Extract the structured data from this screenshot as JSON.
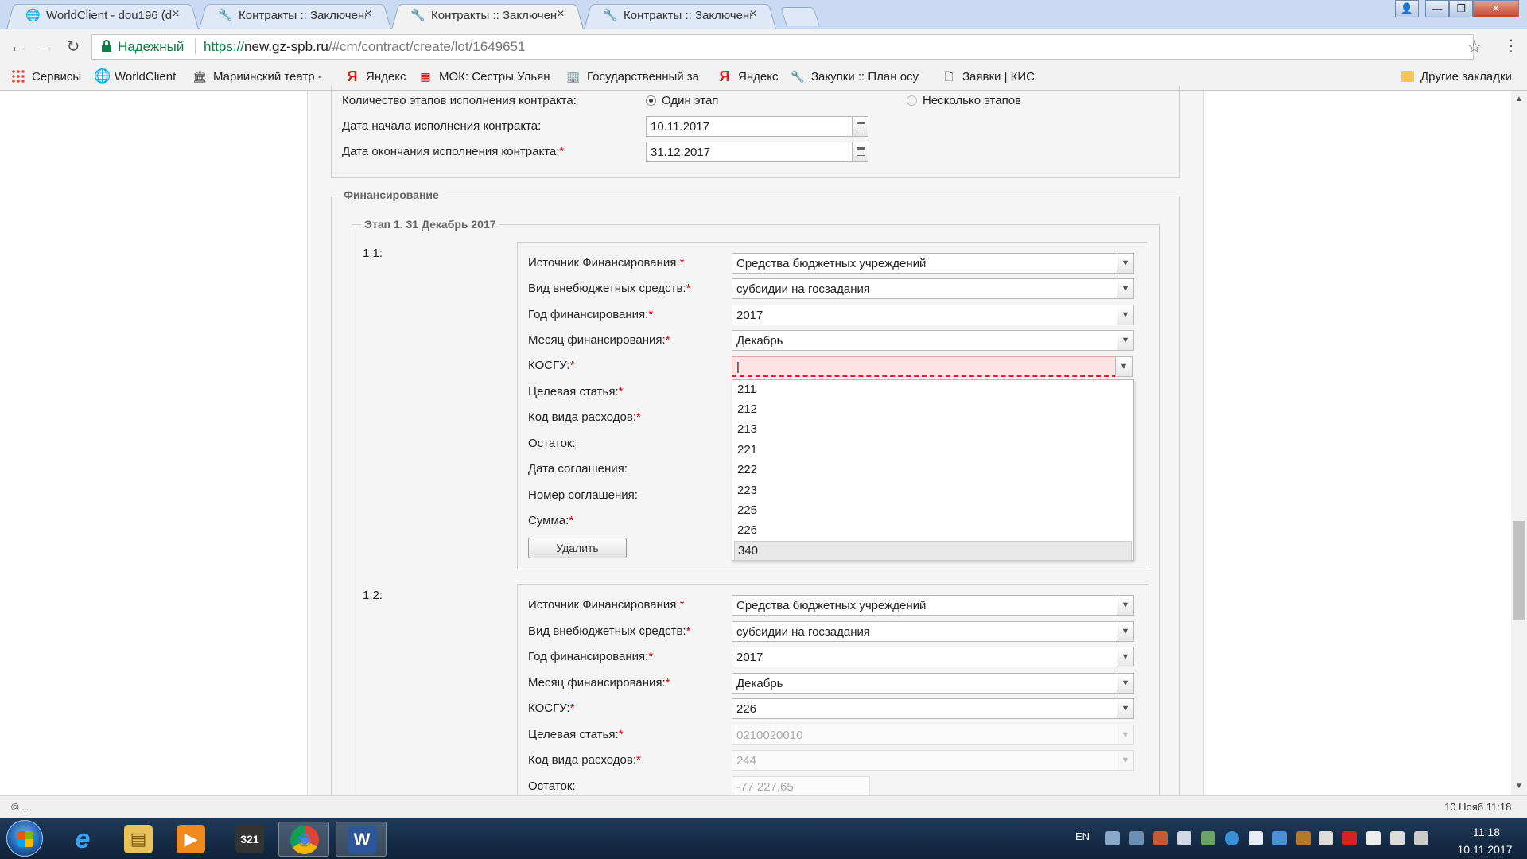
{
  "browser": {
    "tabs": [
      {
        "label": "WorldClient - dou196 (d",
        "icon": "globe-icon",
        "active": false
      },
      {
        "label": "Контракты :: Заключени",
        "icon": "tools-icon",
        "active": false
      },
      {
        "label": "Контракты :: Заключени",
        "icon": "tools-icon",
        "active": true
      },
      {
        "label": "Контракты :: Заключени",
        "icon": "tools-icon",
        "active": false
      }
    ],
    "close_glyph": "×",
    "window_buttons": {
      "user": "👤",
      "minimize": "—",
      "restore": "❐",
      "close": "✕"
    },
    "nav": {
      "back": "←",
      "forward": "→",
      "reload": "↻"
    },
    "security_label": "Надежный",
    "url_scheme": "https://",
    "url_host": "new.gz-spb.ru",
    "url_path": "/#cm/contract/create/lot/1649651",
    "star": "☆",
    "menu": "⋮",
    "bookmarks": [
      {
        "label": "Сервисы",
        "icon": "apps-icon"
      },
      {
        "label": "WorldClient",
        "icon": "globe-icon"
      },
      {
        "label": "Мариинский театр -",
        "icon": "theatre-icon"
      },
      {
        "label": "Яндекс",
        "icon": "yandex-icon"
      },
      {
        "label": "МОК: Сестры Ульян",
        "icon": "mok-icon"
      },
      {
        "label": "Государственный за",
        "icon": "building-icon"
      },
      {
        "label": "Яндекс",
        "icon": "yandex-icon"
      },
      {
        "label": "Закупки :: План осу",
        "icon": "tools-icon"
      },
      {
        "label": "Заявки | КИС",
        "icon": "document-icon"
      }
    ],
    "other_bookmarks": "Другие закладки"
  },
  "contract": {
    "stages_label": "Количество этапов исполнения контракта:",
    "stage_option_one": "Один этап",
    "stage_option_many": "Несколько этапов",
    "start_label": "Дата начала исполнения контракта:",
    "start_value": "10.11.2017",
    "end_label": "Дата окончания исполнения контракта:",
    "end_value": "31.12.2017"
  },
  "financing": {
    "legend": "Финансирование",
    "stage_legend": "Этап 1. 31 Декабрь 2017",
    "required_mark": "*",
    "dropdown_arrow": "▼",
    "item1": {
      "number": "1.1:",
      "source_label": "Источник Финансирования:",
      "source_value": "Средства бюджетных учреждений",
      "funds_label": "Вид внебюджетных средств:",
      "funds_value": "субсидии на госзадания",
      "year_label": "Год финансирования:",
      "year_value": "2017",
      "month_label": "Месяц финансирования:",
      "month_value": "Декабрь",
      "kosgu_label": "КОСГУ:",
      "kosgu_value": "|",
      "target_label": "Целевая статья:",
      "expense_label": "Код вида расходов:",
      "balance_label": "Остаток:",
      "agreement_date_label": "Дата соглашения:",
      "agreement_number_label": "Номер соглашения:",
      "sum_label": "Сумма:",
      "delete_button": "Удалить",
      "kosgu_options": [
        "211",
        "212",
        "213",
        "221",
        "222",
        "223",
        "225",
        "226",
        "340"
      ],
      "kosgu_highlighted": "340"
    },
    "item2": {
      "number": "1.2:",
      "source_label": "Источник Финансирования:",
      "source_value": "Средства бюджетных учреждений",
      "funds_label": "Вид внебюджетных средств:",
      "funds_value": "субсидии на госзадания",
      "year_label": "Год финансирования:",
      "year_value": "2017",
      "month_label": "Месяц финансирования:",
      "month_value": "Декабрь",
      "kosgu_label": "КОСГУ:",
      "kosgu_value": "226",
      "target_label": "Целевая статья:",
      "target_value": "0210020010",
      "expense_label": "Код вида расходов:",
      "expense_value": "244",
      "balance_label": "Остаток:",
      "balance_value": "-77 227,65"
    }
  },
  "statusbar": {
    "left": "© ...",
    "right": "10 Нояб 11:18"
  },
  "taskbar": {
    "lang": "EN",
    "time": "11:18",
    "date": "10.11.2017",
    "apps": [
      {
        "name": "ie-icon",
        "glyph": "e"
      },
      {
        "name": "explorer-icon",
        "glyph": "▤"
      },
      {
        "name": "media-player-icon",
        "glyph": "▶"
      },
      {
        "name": "clapper-icon",
        "glyph": "321"
      },
      {
        "name": "chrome-icon",
        "glyph": "◉"
      },
      {
        "name": "word-icon",
        "glyph": "W"
      }
    ]
  },
  "colors": {
    "secure_green": "#0b8043",
    "required_red": "#e00000",
    "error_bg": "#fde3e3"
  }
}
